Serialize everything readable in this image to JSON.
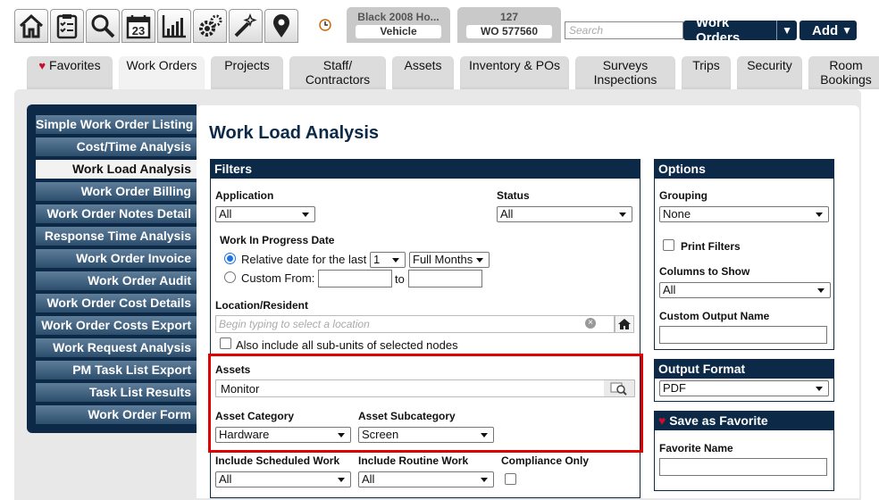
{
  "toolbar": {
    "icons": [
      {
        "name": "home-icon"
      },
      {
        "name": "clipboard-icon"
      },
      {
        "name": "search-icon"
      },
      {
        "name": "calendar-icon",
        "day": "23"
      },
      {
        "name": "bar-chart-icon"
      },
      {
        "name": "gears-icon"
      },
      {
        "name": "magic-wand-icon"
      },
      {
        "name": "map-pin-icon"
      }
    ],
    "recent_items": [
      {
        "title": "Black 2008 Ho...",
        "sub": "Vehicle"
      },
      {
        "title": "127",
        "sub": "WO 577560"
      }
    ],
    "search_placeholder": "Search",
    "module_button": "Work Orders",
    "add_button": "Add",
    "dropdown_arrow": "▼"
  },
  "tabs": [
    {
      "line1": "Favorites",
      "line2": "",
      "heart": "♥"
    },
    {
      "line1": "Work Orders",
      "line2": "",
      "active": true
    },
    {
      "line1": "Projects",
      "line2": ""
    },
    {
      "line1": "Staff/",
      "line2": "Contractors"
    },
    {
      "line1": "Assets",
      "line2": ""
    },
    {
      "line1": "Inventory & POs",
      "line2": ""
    },
    {
      "line1": "Surveys",
      "line2": "Inspections"
    },
    {
      "line1": "Trips",
      "line2": ""
    },
    {
      "line1": "Security",
      "line2": ""
    },
    {
      "line1": "Room",
      "line2": "Bookings"
    }
  ],
  "sidebar": {
    "items": [
      "Simple Work Order Listing",
      "Cost/Time Analysis",
      "Work Load Analysis",
      "Work Order Billing",
      "Work Order Notes Detail",
      "Response Time Analysis",
      "Work Order Invoice",
      "Work Order Audit",
      "Work Order Cost Details",
      "Work Order Costs Export",
      "Work Request Analysis",
      "PM Task List Export",
      "Task List Results",
      "Work Order Form"
    ],
    "active_index": 2
  },
  "page_title": "Work Load Analysis",
  "filters": {
    "header": "Filters",
    "application_label": "Application",
    "application_value": "All",
    "status_label": "Status",
    "status_value": "All",
    "wip_label": "Work In Progress Date",
    "relative_label": "Relative date for the last",
    "relative_count": "1",
    "relative_unit": "Full Months",
    "custom_label": "Custom From:",
    "to_label": "to",
    "location_label": "Location/Resident",
    "location_placeholder": "Begin typing to select a location",
    "subunits_label": "Also include all sub-units of selected nodes",
    "assets_label": "Assets",
    "assets_value": "Monitor",
    "asset_category_label": "Asset Category",
    "asset_category_value": "Hardware",
    "asset_subcategory_label": "Asset Subcategory",
    "asset_subcategory_value": "Screen",
    "scheduled_label": "Include Scheduled Work",
    "scheduled_value": "All",
    "routine_label": "Include Routine Work",
    "routine_value": "All",
    "compliance_label": "Compliance Only"
  },
  "options": {
    "header": "Options",
    "grouping_label": "Grouping",
    "grouping_value": "None",
    "print_filters_label": "Print Filters",
    "columns_label": "Columns to Show",
    "columns_value": "All",
    "custom_output_label": "Custom Output Name"
  },
  "output_format": {
    "header": "Output Format",
    "value": "PDF"
  },
  "save_favorite": {
    "header": "Save as Favorite",
    "heart": "♥",
    "name_label": "Favorite Name"
  },
  "colors": {
    "navy": "#0c2a47",
    "highlight": "#e00000",
    "sidebar_item": "#3f607f"
  }
}
